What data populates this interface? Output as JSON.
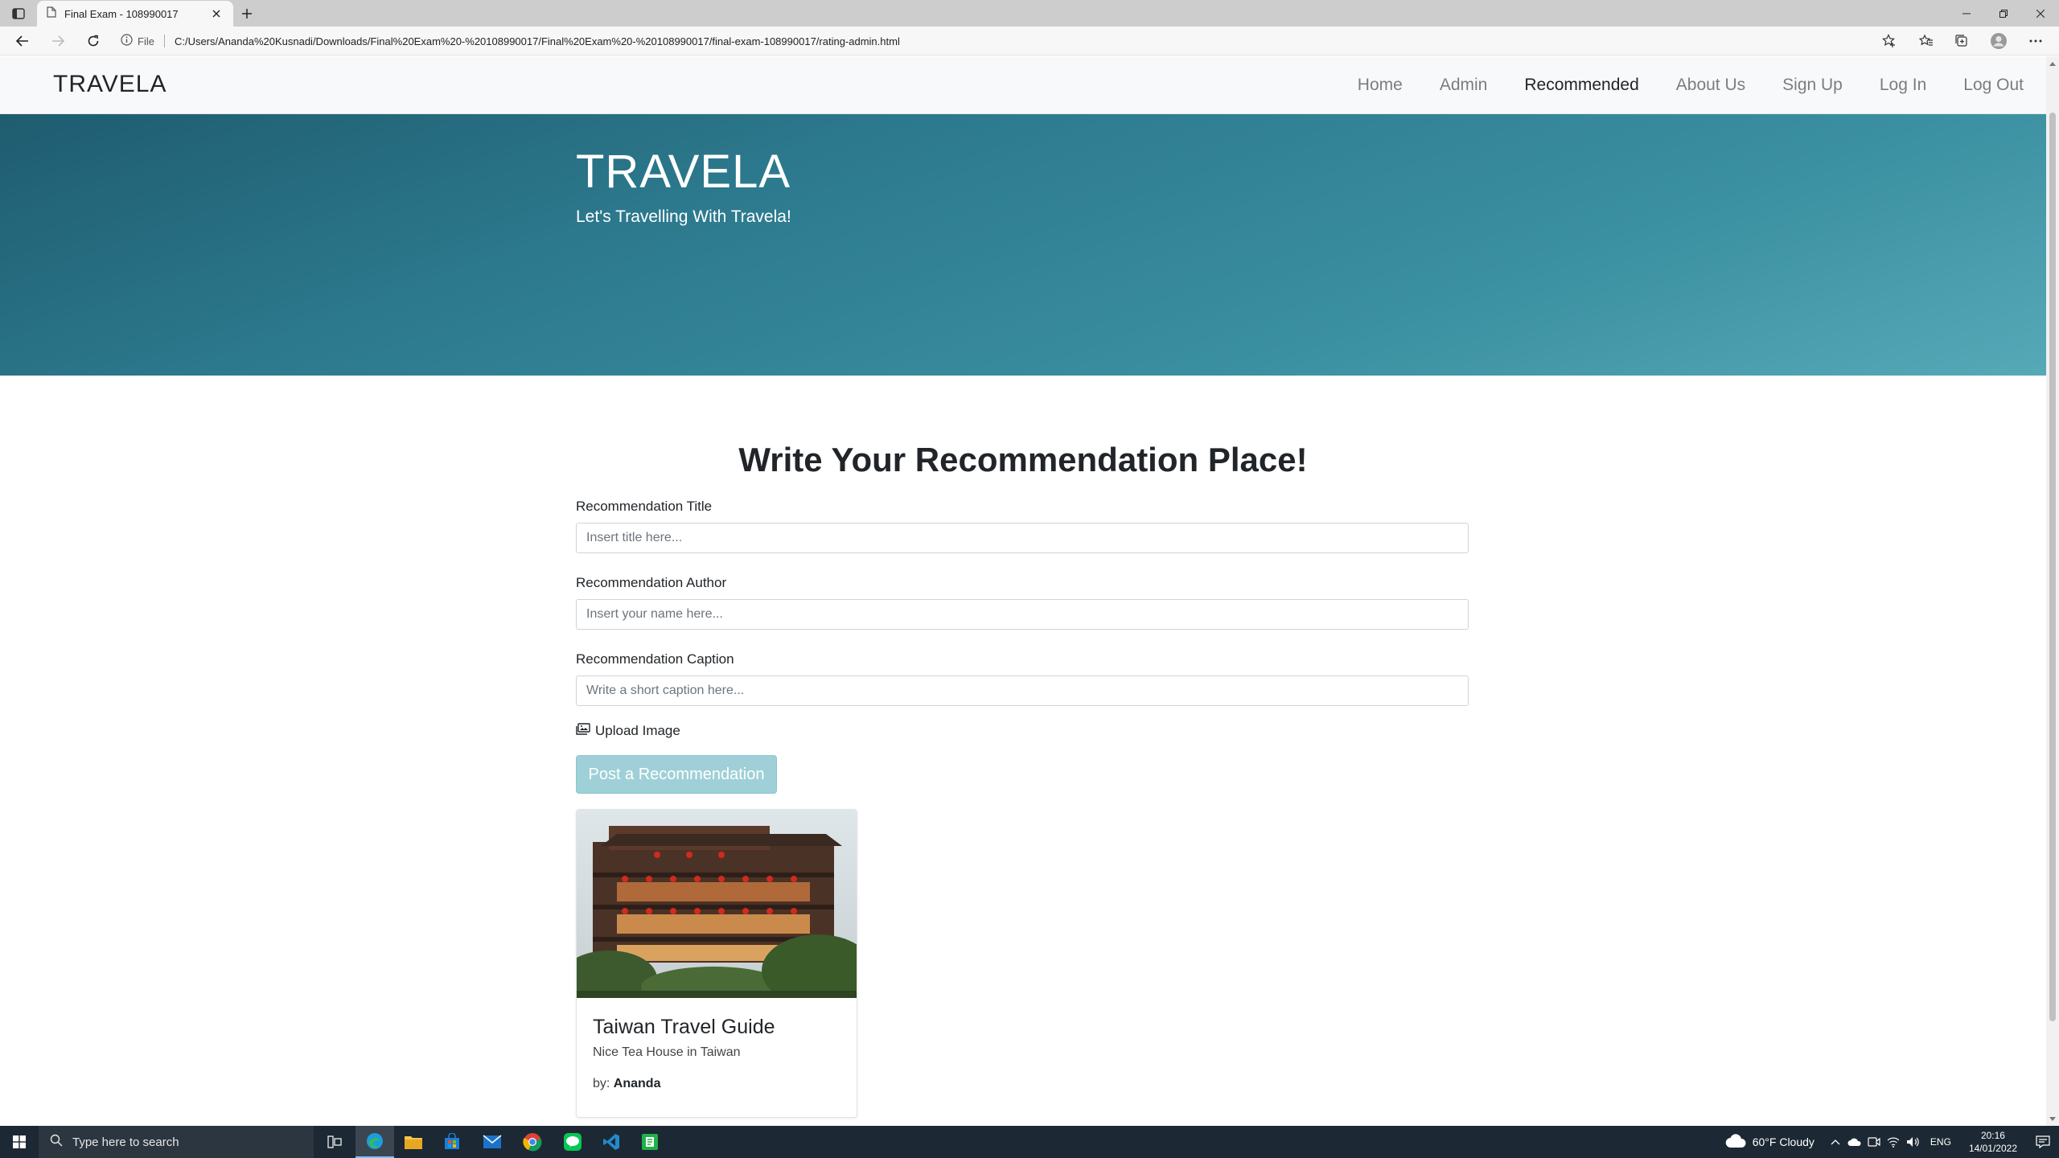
{
  "browser": {
    "tab_title": "Final Exam - 108990017",
    "address_scheme": "File",
    "url": "C:/Users/Ananda%20Kusnadi/Downloads/Final%20Exam%20-%20108990017/Final%20Exam%20-%20108990017/final-exam-108990017/rating-admin.html"
  },
  "navbar": {
    "brand": "TRAVELA",
    "links": [
      "Home",
      "Admin",
      "Recommended",
      "About Us",
      "Sign Up",
      "Log In",
      "Log Out"
    ],
    "active": "Recommended"
  },
  "hero": {
    "title": "TRAVELA",
    "subtitle": "Let's Travelling With Travela!"
  },
  "form": {
    "heading": "Write Your Recommendation Place!",
    "title_label": "Recommendation Title",
    "title_placeholder": "Insert title here...",
    "author_label": "Recommendation Author",
    "author_placeholder": "Insert your name here...",
    "caption_label": "Recommendation Caption",
    "caption_placeholder": "Write a short caption here...",
    "upload_label": "Upload Image",
    "submit_label": "Post a Recommendation"
  },
  "card": {
    "title": "Taiwan Travel Guide",
    "caption": "Nice Tea House in Taiwan",
    "by_label": "by:",
    "author": "Ananda"
  },
  "taskbar": {
    "search_placeholder": "Type here to search",
    "weather": "60°F  Cloudy",
    "language": "ENG",
    "time": "20:16",
    "date": "14/01/2022"
  },
  "colors": {
    "hero_gradient_start": "#1f5c70",
    "hero_gradient_end": "#56a9b7",
    "button_bg": "#9fd0d8",
    "navbar_bg": "#f8f9fa",
    "taskbar_bg": "#1c2833"
  },
  "icons": {
    "tab_actions": "tab-actions-icon",
    "page": "page-icon",
    "close": "close-icon",
    "new_tab": "plus-icon",
    "back": "back-arrow-icon",
    "forward": "forward-arrow-icon",
    "refresh": "refresh-icon",
    "info": "info-icon",
    "upload": "images-icon"
  }
}
